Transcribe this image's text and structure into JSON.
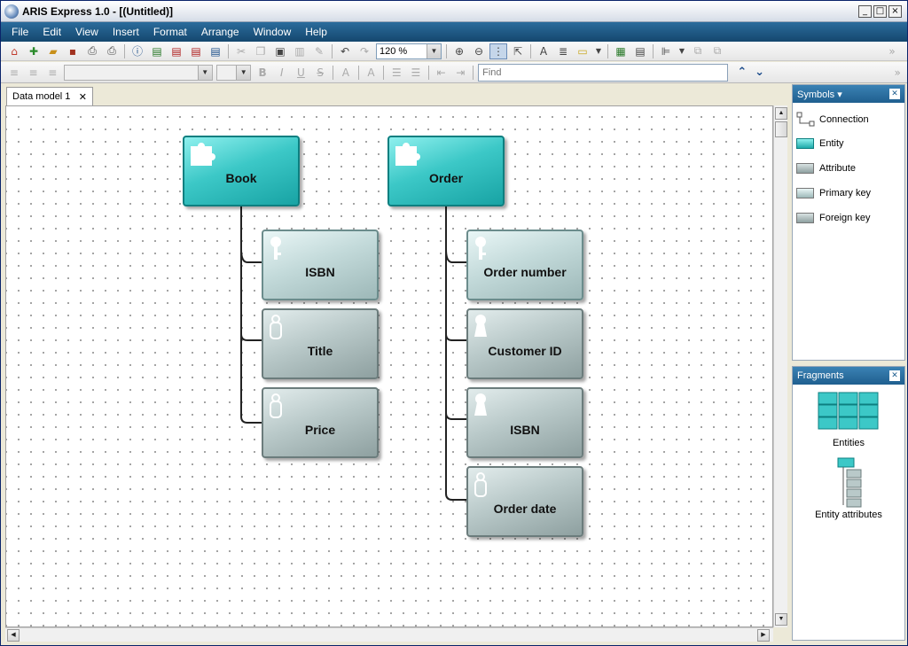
{
  "window": {
    "title": "ARIS Express 1.0 - [(Untitled)]"
  },
  "menu": [
    "File",
    "Edit",
    "View",
    "Insert",
    "Format",
    "Arrange",
    "Window",
    "Help"
  ],
  "toolbar": {
    "zoom": "120 %",
    "find_placeholder": "Find"
  },
  "tab": {
    "label": "Data model 1"
  },
  "diagram": {
    "entities": [
      {
        "label": "Book",
        "attributes": [
          {
            "label": "ISBN",
            "kind": "primary-key"
          },
          {
            "label": "Title",
            "kind": "attribute"
          },
          {
            "label": "Price",
            "kind": "attribute"
          }
        ]
      },
      {
        "label": "Order",
        "attributes": [
          {
            "label": "Order number",
            "kind": "primary-key"
          },
          {
            "label": "Customer ID",
            "kind": "foreign-key"
          },
          {
            "label": "ISBN",
            "kind": "foreign-key"
          },
          {
            "label": "Order date",
            "kind": "attribute"
          }
        ]
      }
    ]
  },
  "symbols_panel": {
    "title": "Symbols",
    "items": [
      "Connection",
      "Entity",
      "Attribute",
      "Primary key",
      "Foreign key"
    ]
  },
  "fragments_panel": {
    "title": "Fragments",
    "items": [
      "Entities",
      "Entity attributes"
    ]
  },
  "colors": {
    "entity": "#2dbdbd",
    "attribute": "#a9b9b9",
    "menubar": "#1f5a85"
  }
}
